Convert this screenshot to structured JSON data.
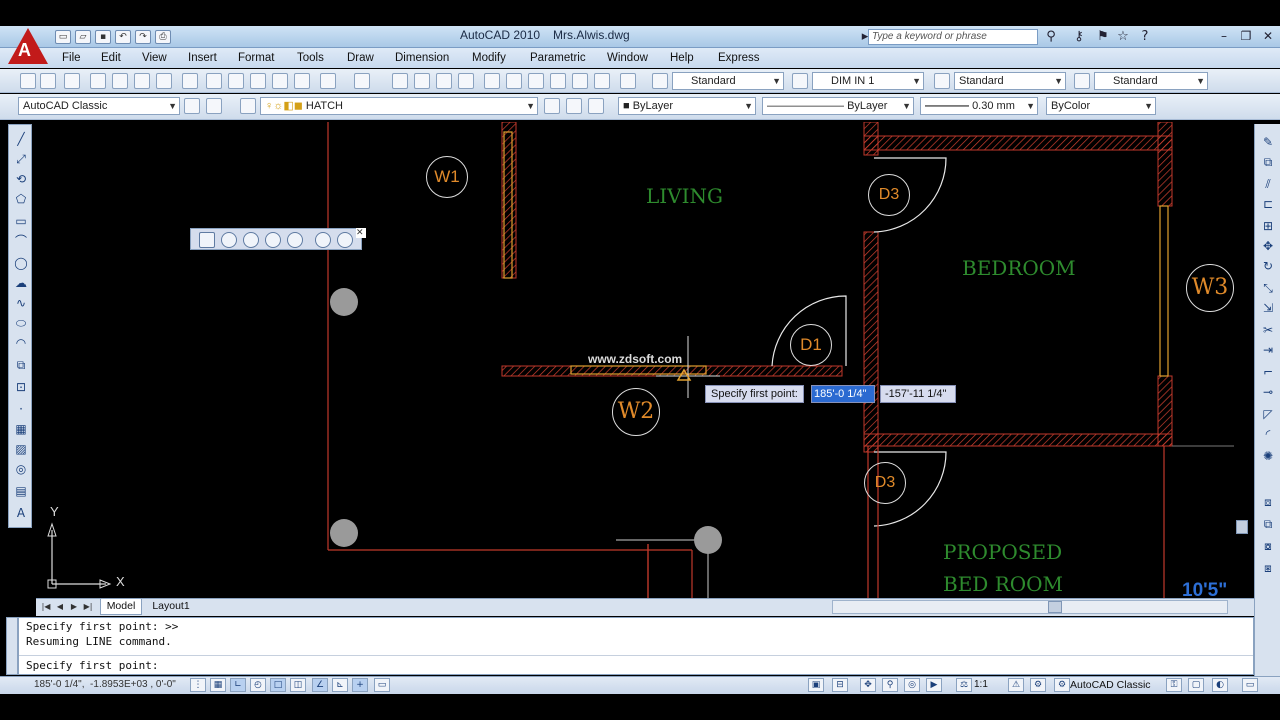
{
  "title_bar": {
    "app_name": "AutoCAD 2010",
    "file_name": "Mrs.Alwis.dwg",
    "search_placeholder": "Type a keyword or phrase",
    "logo_letter": "A"
  },
  "menu": [
    "File",
    "Edit",
    "View",
    "Insert",
    "Format",
    "Tools",
    "Draw",
    "Dimension",
    "Modify",
    "Parametric",
    "Window",
    "Help",
    "Express"
  ],
  "styles_toolbar": {
    "text_style": "Standard",
    "dim_style": "DIM IN 1",
    "table_style": "Standard",
    "multileader_style": "Standard"
  },
  "layers_toolbar": {
    "workspace": "AutoCAD Classic",
    "layer": "HATCH",
    "color": "ByLayer",
    "linetype": "ByLayer",
    "lineweight": "0.30 mm",
    "plotstyle": "ByColor"
  },
  "drawing": {
    "rooms": {
      "living": "LIVING",
      "bedroom": "BEDROOM",
      "proposed_line1": "PROPOSED",
      "proposed_line2": "BED ROOM"
    },
    "tags": {
      "w1": "W1",
      "w2": "W2",
      "w3": "W3",
      "d1": "D1",
      "d3_top": "D3",
      "d3_bottom": "D3"
    },
    "watermark": "www.zdsoft.com",
    "dimension_text": "10'5\"",
    "ucs_x": "X",
    "ucs_y": "Y"
  },
  "dynamic_input": {
    "prompt": "Specify first point:",
    "x_value": "185'-0 1/4\"",
    "y_value": "-157'-11 1/4\""
  },
  "layout_tabs": {
    "model": "Model",
    "layout1": "Layout1"
  },
  "command_window": {
    "line1": "Specify first point: >>",
    "line2": "Resuming LINE command.",
    "prompt": "Specify first point:"
  },
  "status_bar": {
    "coordinates": "185'-0 1/4\",  -1.8953E+03 , 0'-0\"",
    "annotation_scale": "1:1",
    "workspace": "AutoCAD Classic"
  },
  "colors": {
    "room_label": "#2e8b2e",
    "tag_text": "#e08a2a",
    "wall": "#c0392b",
    "highlight_input": "#2b6ad1"
  }
}
